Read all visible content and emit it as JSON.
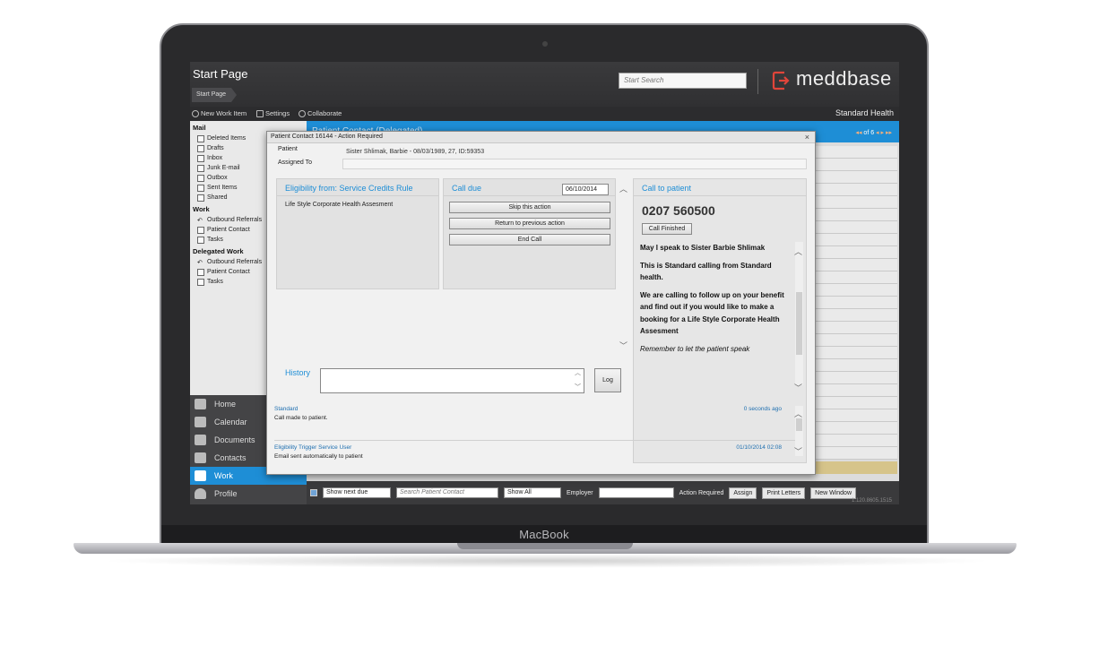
{
  "device": {
    "label": "MacBook"
  },
  "app": {
    "title": "Start Page",
    "breadcrumb": "Start Page",
    "search_placeholder": "Start Search",
    "brand": "meddbase",
    "brand_color": "#e0453a",
    "accent_color": "#1e8ed6",
    "tenant": "Standard Health"
  },
  "toolbar": {
    "new_work_item": "New Work Item",
    "settings": "Settings",
    "collaborate": "Collaborate"
  },
  "sidebar": {
    "mail_heading": "Mail",
    "mail_items": [
      "Deleted Items",
      "Drafts",
      "Inbox",
      "Junk E-mail",
      "Outbox",
      "Sent Items",
      "Shared"
    ],
    "work_heading": "Work",
    "work_items": [
      "Outbound Referrals",
      "Patient Contact",
      "Tasks"
    ],
    "delegated_heading": "Delegated Work",
    "delegated_items": [
      "Outbound Referrals",
      "Patient Contact",
      "Tasks"
    ]
  },
  "nav": {
    "items": [
      "Home",
      "Calendar",
      "Documents",
      "Contacts",
      "Work",
      "Profile"
    ],
    "active": "Work"
  },
  "main": {
    "header": "Patient Contact (Delegated)",
    "pager": "of 6"
  },
  "bottom_bar": {
    "show_next_due": "Show next due",
    "search_placeholder": "Search Patient Contact",
    "show_all": "Show All",
    "employer_label": "Employer",
    "action_required": "Action Required",
    "assign": "Assign",
    "print_letters": "Print Letters",
    "new_window": "New Window",
    "version": "1.120.8605.1515"
  },
  "dialog": {
    "title": "Patient Contact 16144 - Action Required",
    "close": "×",
    "patient_label": "Patient",
    "patient_value": "Sister Shlimak, Barbie - 08/03/1989, 27, ID:59353",
    "assigned_label": "Assigned To",
    "eligibility_title": "Eligibility from: Service Credits Rule",
    "eligibility_item": "Life Style Corporate Health Assesment",
    "call_due_title": "Call due",
    "call_due_date": "06/10/2014",
    "skip_action": "Skip this action",
    "return_previous": "Return to previous action",
    "end_call": "End Call",
    "call_to_patient_title": "Call to patient",
    "phone": "0207 560500",
    "call_finished": "Call Finished",
    "script": [
      "May I speak to Sister Barbie Shlimak",
      "This is Standard calling from Standard health.",
      "We are calling to follow up on your benefit and find out if you would like to make a booking for a Life Style Corporate Health Assesment"
    ],
    "script_note": "Remember to let the patient speak",
    "history_title": "History",
    "log_button": "Log",
    "history": [
      {
        "source": "Standard",
        "message": "Call made to patient.",
        "time": "0 seconds ago"
      },
      {
        "source": "Eligibility Trigger Service User",
        "message": "Email sent automatically to patient",
        "time": "01/10/2014 02:08"
      }
    ]
  }
}
